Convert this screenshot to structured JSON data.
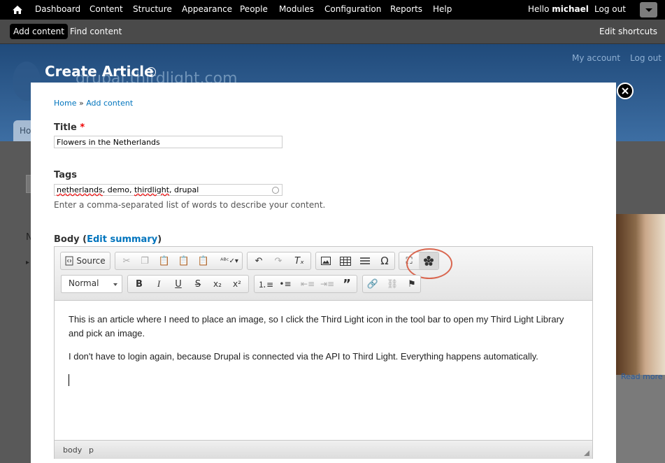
{
  "toolbar": {
    "nav": [
      "Dashboard",
      "Content",
      "Structure",
      "Appearance",
      "People",
      "Modules",
      "Configuration",
      "Reports",
      "Help"
    ],
    "hello_prefix": "Hello ",
    "username": "michael",
    "logout": "Log out"
  },
  "shortcuts": {
    "add_content": "Add content",
    "find_content": "Find content",
    "edit_shortcuts": "Edit shortcuts"
  },
  "site": {
    "name": "drupal.thirdlight.com",
    "my_account": "My account",
    "log_out": "Log out",
    "tab": "Ho",
    "read_more": "Read more"
  },
  "overlay": {
    "title": "Create Article"
  },
  "breadcrumb": {
    "home": "Home",
    "sep": " » ",
    "add_content": "Add content"
  },
  "form": {
    "title_label": "Title",
    "required_mark": "*",
    "title_value": "Flowers in the Netherlands",
    "tags_label": "Tags",
    "tags_value_parts": [
      "netherlands",
      ", demo, ",
      "thirdlight",
      ", drupal"
    ],
    "tags_description": "Enter a comma-separated list of words to describe your content.",
    "body_label": "Body",
    "edit_summary": "Edit summary"
  },
  "editor": {
    "source_label": "Source",
    "format_value": "Normal",
    "paragraphs": [
      "This is an article where I need to place an image, so I click the Third Light icon in the tool bar to open my Third Light Library and pick an image.",
      "I don't have to login again, because Drupal is connected via the API to Third Light. Everything happens automatically."
    ],
    "path": [
      "body",
      "p"
    ]
  },
  "colors": {
    "link": "#0074bd",
    "highlight_ring": "#d9664f",
    "toolbar_bg": "#000000"
  }
}
